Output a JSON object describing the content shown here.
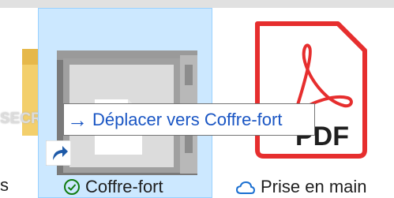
{
  "files": [
    {
      "name_fragment": "s",
      "icon": "folder-zip-icon",
      "overlay_text": "SECRE"
    },
    {
      "name": "Coffre-fort",
      "status_icon": "synced-check-icon",
      "icon": "safe-vault-icon",
      "selected": true
    },
    {
      "name": "Prise en main",
      "status_icon": "cloud-icon",
      "icon": "pdf-file-icon",
      "icon_text": "PDF"
    }
  ],
  "drag_tooltip": {
    "arrow": "→",
    "text": "Déplacer vers Coffre-fort"
  },
  "colors": {
    "selection": "#cce8ff",
    "tooltip_text": "#1a56c4",
    "pdf_red": "#e62e2e",
    "check_green": "#107c10",
    "cloud_blue": "#1a6fd1"
  }
}
